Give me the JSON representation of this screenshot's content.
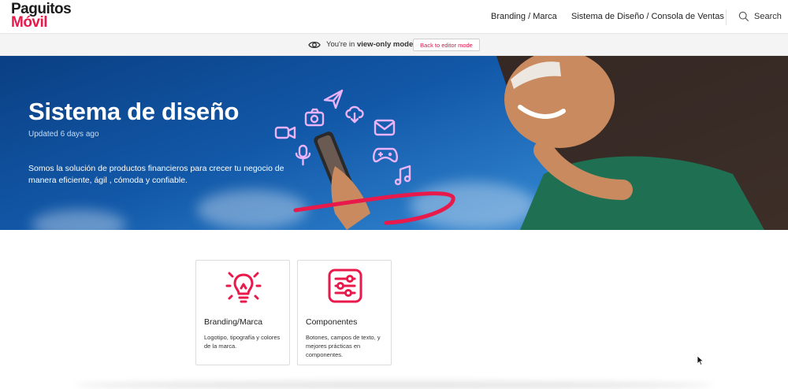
{
  "brand": {
    "line1": "Paguitos",
    "line2": "Móvil",
    "accent": "#e8194b"
  },
  "nav": {
    "links": [
      "Branding / Marca",
      "Sistema de Diseño / Consola de Ventas"
    ],
    "search_label": "Search",
    "search_icon": "search-icon"
  },
  "view_banner": {
    "prefix": "You're in ",
    "mode": "view-only mode",
    "button": "Back to editor mode",
    "icon": "eye-icon"
  },
  "hero": {
    "title": "Sistema de diseño",
    "updated": "Updated 6 days ago",
    "description": "Somos la solución de productos financieros para crecer tu negocio de manera eficiente, ágil , cómoda y confiable."
  },
  "cards": [
    {
      "title": "Branding/Marca",
      "description": "Logotipo, tipografía y colores de la marca.",
      "icon": "lightbulb-icon"
    },
    {
      "title": "Componentes",
      "description": "Botones, campos de texto, y mejores prácticas en componentes.",
      "icon": "sliders-icon"
    }
  ]
}
